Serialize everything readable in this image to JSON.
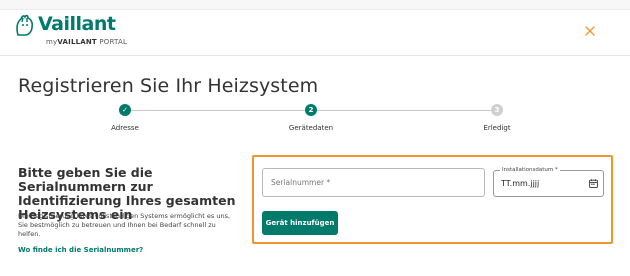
{
  "header": {
    "brand_name": "Vaillant",
    "portal_prefix": "my",
    "portal_brand": "VAILLANT",
    "portal_suffix": " PORTAL",
    "brand_color": "#007a6a"
  },
  "page": {
    "title": "Registrieren Sie Ihr Heizsystem"
  },
  "stepper": {
    "steps": [
      {
        "label": "Adresse",
        "state": "done",
        "marker": "✓"
      },
      {
        "label": "Gerätedaten",
        "state": "active",
        "marker": "2"
      },
      {
        "label": "Erledigt",
        "state": "todo",
        "marker": "3"
      }
    ]
  },
  "section": {
    "heading": "Bitte geben Sie die Serialnummern zur Identifizierung Ihres gesamten Heizsystems ein",
    "description": "Die Registrierung Ihres vollständigen Systems ermöglicht es uns, Sie bestmöglich zu betreuen und Ihnen bei Bedarf schnell zu helfen.",
    "help_link": "Wo finde ich die Serialnummer?"
  },
  "form": {
    "serial_placeholder": "Serialnummer *",
    "serial_value": "",
    "date_label": "Installationsdatum *",
    "date_value": "TT.mm.jjjj",
    "add_button": "Gerät hinzufügen"
  },
  "colors": {
    "highlight": "#f0962e",
    "accent": "#007a6a"
  }
}
